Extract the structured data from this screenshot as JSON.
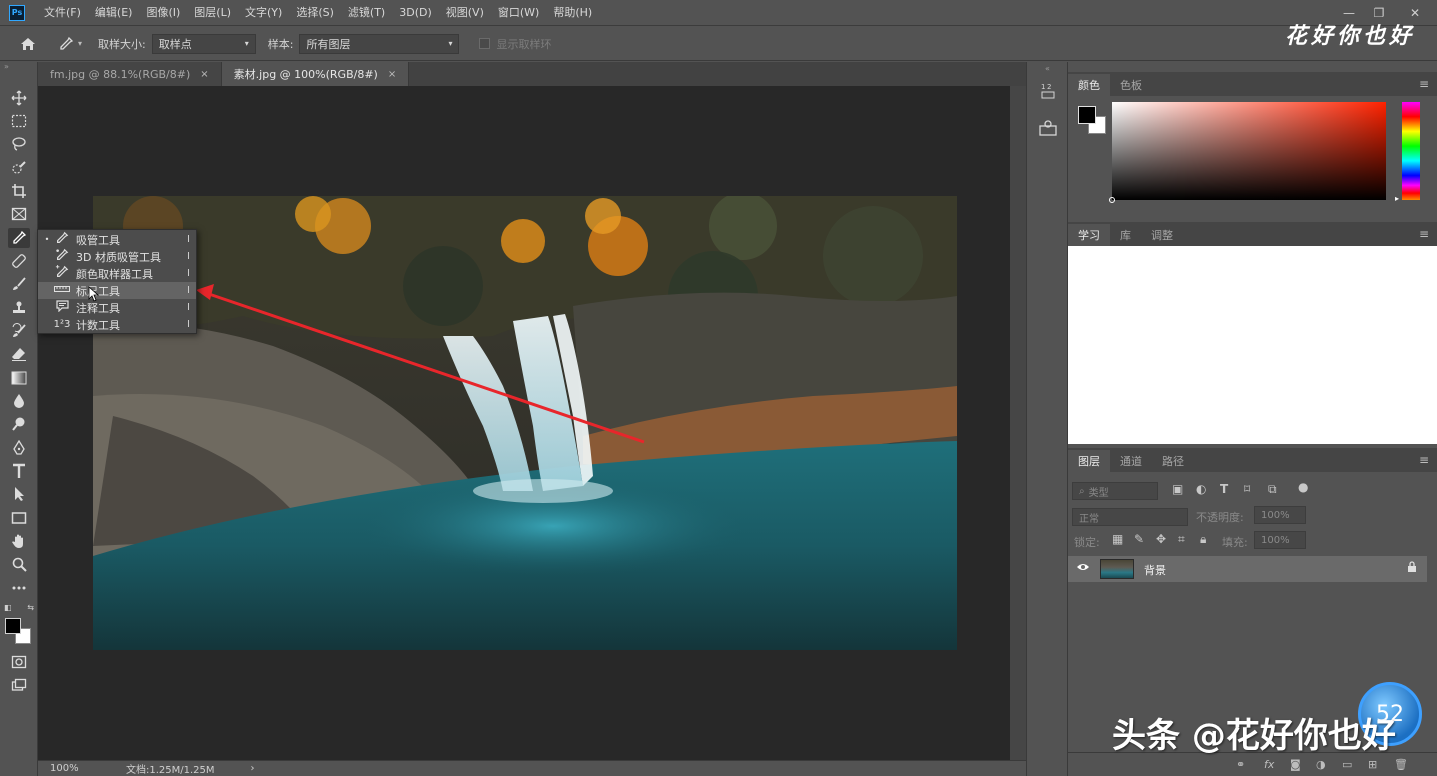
{
  "app": {
    "logo": "Ps"
  },
  "menu": [
    "文件(F)",
    "编辑(E)",
    "图像(I)",
    "图层(L)",
    "文字(Y)",
    "选择(S)",
    "滤镜(T)",
    "3D(D)",
    "视图(V)",
    "窗口(W)",
    "帮助(H)"
  ],
  "window_controls": {
    "minimize": "—",
    "restore": "❐",
    "close": "✕"
  },
  "options": {
    "sample_size_label": "取样大小:",
    "sample_size_value": "取样点",
    "sample_label": "样本:",
    "sample_value": "所有图层",
    "show_ring_label": "显示取样环"
  },
  "watermark_top": "花好你也好",
  "tabs": [
    {
      "label": "fm.jpg @ 88.1%(RGB/8#)",
      "close": "×"
    },
    {
      "label": "素材.jpg @ 100%(RGB/8#)",
      "close": "×"
    }
  ],
  "flyout": {
    "items": [
      {
        "label": "吸管工具",
        "key": "I",
        "icon": "eyedropper-icon",
        "selected": true
      },
      {
        "label": "3D 材质吸管工具",
        "key": "I",
        "icon": "3d-eyedropper-icon",
        "selected": false
      },
      {
        "label": "颜色取样器工具",
        "key": "I",
        "icon": "color-sampler-icon",
        "selected": false
      },
      {
        "label": "标尺工具",
        "key": "I",
        "icon": "ruler-icon",
        "selected": false
      },
      {
        "label": "注释工具",
        "key": "I",
        "icon": "note-icon",
        "selected": false
      },
      {
        "label": "计数工具",
        "key": "I",
        "icon": "count-icon",
        "selected": false
      }
    ],
    "bullet": "•",
    "count_glyph": "1²3"
  },
  "status": {
    "zoom": "100%",
    "doc": "文档:1.25M/1.25M",
    "arrow": "›"
  },
  "panels": {
    "color_tabs": [
      "颜色",
      "色板"
    ],
    "learn_tabs": [
      "学习",
      "库",
      "调整"
    ],
    "layers_tabs": [
      "图层",
      "通道",
      "路径"
    ],
    "filter_kind": "类型",
    "blend_mode": "正常",
    "opacity_label": "不透明度:",
    "opacity_value": "100%",
    "lock_label": "锁定:",
    "fill_label": "填充:",
    "fill_value": "100%",
    "layer_name": "背景"
  },
  "badge_number": "52",
  "watermark_bottom": "头条 @花好你也好",
  "colors": {
    "foreground": "#000000",
    "background": "#ffffff",
    "picker_hue": "#ff2200",
    "accent": "#31a8ff",
    "arrow": "#e8262b"
  }
}
